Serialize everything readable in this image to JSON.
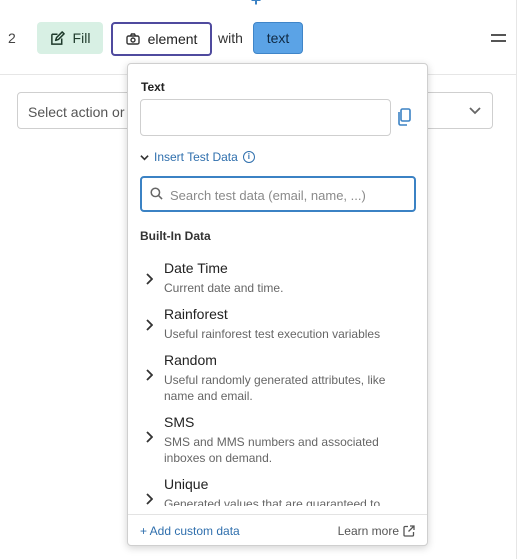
{
  "step": {
    "number": "2",
    "fill_label": "Fill",
    "element_label": "element",
    "with_label": "with",
    "text_label": "text",
    "add_icon": "plus-icon",
    "menu_icon": "drag-handle-icon"
  },
  "select_action": {
    "placeholder": "Select action or"
  },
  "popover": {
    "text_field_label": "Text",
    "text_field_value": "",
    "insert_test_data_label": "Insert Test Data",
    "search_placeholder": "Search test data (email, name, ...)",
    "section_title": "Built-In Data",
    "items": [
      {
        "title": "Date Time",
        "desc": "Current date and time."
      },
      {
        "title": "Rainforest",
        "desc": "Useful rainforest test execution variables"
      },
      {
        "title": "Random",
        "desc": "Useful randomly generated attributes, like name and email."
      },
      {
        "title": "SMS",
        "desc": "SMS and MMS numbers and associated inboxes on demand."
      },
      {
        "title": "Unique",
        "desc": "Generated values that are guaranteed to"
      }
    ],
    "add_custom_label": "+ Add custom data",
    "learn_more_label": "Learn more"
  },
  "colors": {
    "accent_blue": "#3b82c4",
    "fill_chip_bg": "#d8f0e4",
    "element_border": "#4f4a9e",
    "text_chip_bg": "#5ba3e6"
  }
}
